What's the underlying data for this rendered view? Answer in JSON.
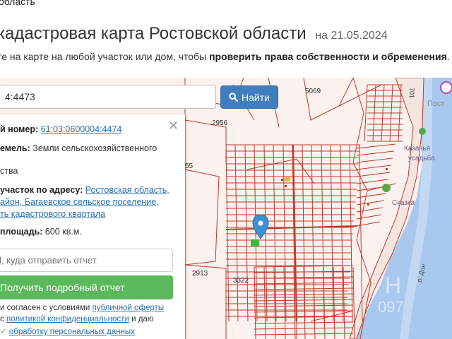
{
  "header": {
    "breadcrumb": "область",
    "title": "кадастровая карта Ростовской области",
    "date": "на 21.05.2024",
    "subtitle_pre": "те на карте на любой участок или дом, чтобы ",
    "subtitle_bold": "проверить права собственности и обременения",
    "subtitle_post": "."
  },
  "search": {
    "value": "4:4473",
    "button_label": "Найти"
  },
  "panel": {
    "cad_label": "й номер:",
    "cad_value": "61:03:0600004:4474",
    "land_label": "емель:",
    "land_value": "Земли сельскохозяйственного",
    "land_value2": "ства",
    "addr_label": "участок по адресу:",
    "addr_line1": "Ростовская область,",
    "addr_line2": "айон, Багаевское сельское поселение,",
    "addr_line3": "ть кадастрового квартала",
    "area_label": "площадь:",
    "area_value": "600 кв.м.",
    "email_placeholder": "l, куда отправить отчет",
    "report_button": "Получить подробный отчет",
    "consent1_pre": "и согласен с условиями ",
    "consent1_link": "публичной оферты",
    "consent2_pre": "с ",
    "consent2_link": "политикой конфиденциальности",
    "consent2_post": " и даю",
    "consent3_link": "обработку персональных данных"
  },
  "map": {
    "labels": {
      "l5069": "5069",
      "l2956": "2956",
      "l55": "55",
      "l2913": "2913",
      "l3322": "3322",
      "l701": "701",
      "lpost": "Пост",
      "lkaz": "Казачья",
      "lusad": "усадьба",
      "lskaz": "Сказка",
      "lriver": "р. Дон",
      "lwm1": "Н",
      "lwm2": "097"
    },
    "colors": {
      "parcel": "#c0392b",
      "water": "#a9c8ee",
      "marker": "#3d8fd6",
      "selected": "#33bb44"
    }
  }
}
